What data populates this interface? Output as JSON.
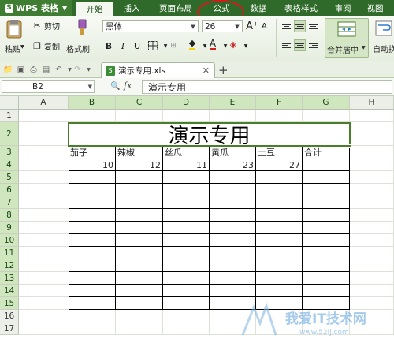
{
  "titlebar": {
    "app_label": "WPS 表格",
    "tabs": [
      "开始",
      "插入",
      "页面布局",
      "公式",
      "数据",
      "表格样式",
      "审阅",
      "视图"
    ]
  },
  "ribbon": {
    "paste": "粘贴",
    "cut": "剪切",
    "copy": "复制",
    "format_painter": "格式刷",
    "font_name": "黑体",
    "font_size": "26",
    "merge_center": "合并居中",
    "auto_wrap": "自动换"
  },
  "docbar": {
    "filename": "演示专用.xls"
  },
  "formula_bar": {
    "name_box": "B2",
    "fx": "fx",
    "content": "演示专用"
  },
  "grid": {
    "columns": [
      "A",
      "B",
      "C",
      "D",
      "E",
      "F",
      "G",
      "H"
    ],
    "rows": [
      "1",
      "2",
      "3",
      "4",
      "5",
      "6",
      "7",
      "8",
      "9",
      "10",
      "11",
      "12",
      "13",
      "14",
      "15",
      "16",
      "17"
    ],
    "title": "演示专用",
    "headers": [
      "茄子",
      "辣椒",
      "丝瓜",
      "黄瓜",
      "土豆",
      "合计"
    ],
    "values": [
      "10",
      "12",
      "11",
      "23",
      "27",
      ""
    ]
  },
  "watermark": {
    "text": "我爱IT技术网",
    "url": "www.52ij.com"
  },
  "colors": {
    "titlebar": "#2f6a2a",
    "selection": "#4a7d2c",
    "annotation_circle": "#d41b1b"
  }
}
